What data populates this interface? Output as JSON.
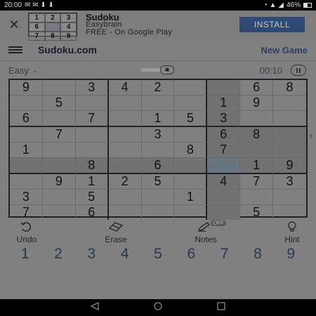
{
  "status_bar": {
    "time": "20:00",
    "battery": "46%"
  },
  "ad": {
    "icon_digits": [
      "1",
      "2",
      "3",
      "6",
      "",
      "4",
      "7",
      "8",
      "9"
    ],
    "title": "Sudoku",
    "developer": "Easybrain",
    "subtitle": "FREE - On Google Play",
    "install_label": "INSTALL"
  },
  "header": {
    "brand": "Sudoku.com",
    "new_game_label": "New Game"
  },
  "game_info": {
    "difficulty": "Easy",
    "timer": "00:10"
  },
  "board": {
    "rows": [
      [
        "9",
        "",
        "3",
        "4",
        "2",
        "",
        "",
        "6",
        "8"
      ],
      [
        "",
        "5",
        "",
        "",
        "",
        "",
        "1",
        "9",
        ""
      ],
      [
        "6",
        "",
        "7",
        "",
        "1",
        "5",
        "3",
        "",
        ""
      ],
      [
        "",
        "7",
        "",
        "",
        "3",
        "",
        "6",
        "8",
        ""
      ],
      [
        "1",
        "",
        "",
        "",
        "",
        "8",
        "7",
        "",
        ""
      ],
      [
        "",
        "",
        "8",
        "",
        "6",
        "",
        "",
        "1",
        "9"
      ],
      [
        "",
        "9",
        "1",
        "2",
        "5",
        "",
        "4",
        "7",
        "3"
      ],
      [
        "3",
        "",
        "5",
        "",
        "",
        "1",
        "",
        "",
        ""
      ],
      [
        "7",
        "",
        "6",
        "",
        "",
        "",
        "",
        "5",
        ""
      ]
    ],
    "selected_row": 5,
    "selected_col": 6
  },
  "tools": {
    "undo_label": "Undo",
    "erase_label": "Erase",
    "notes_label": "Notes",
    "notes_badge": "OFF",
    "hint_label": "Hint"
  },
  "numpad": [
    "1",
    "2",
    "3",
    "4",
    "5",
    "6",
    "7",
    "8",
    "9"
  ],
  "colors": {
    "accent": "#2b3f6e",
    "install_bg": "#2e4a72"
  }
}
